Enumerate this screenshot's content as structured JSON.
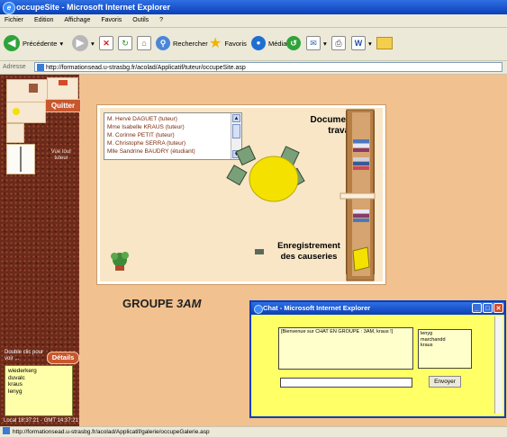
{
  "window": {
    "title": "occupeSite - Microsoft Internet Explorer"
  },
  "menu": [
    "Fichier",
    "Edition",
    "Affichage",
    "Favoris",
    "Outils",
    "?"
  ],
  "toolbar": {
    "back_label": "Précédente",
    "search_label": "Rechercher",
    "favorites_label": "Favoris",
    "media_label": "Média"
  },
  "address": {
    "label": "Adresse",
    "url": "http://formationsead.u-strasbg.fr/acolad/Applicatif/tuteur/occupeSite.asp"
  },
  "sidebar": {
    "quit_label": "Quitter",
    "tutor_move_label": "Vue tour tuteur",
    "dblclick_label": "Double clic pour voir ...",
    "details_label": "Détails",
    "users": [
      "wiederkerg",
      "duvalc",
      "kraus",
      "lenyg"
    ],
    "local_time": "Local 18:37:21 - GMT 14:37:21"
  },
  "room": {
    "tutors": [
      "M. Hervé DAGUET (tuteur)",
      "Mme Isabelle KRAUS (tuteur)",
      "M. Corinne PETIT (tuteur)",
      "M. Christophe SERRA (tuteur)",
      "Mlle Sandrine BAUDRY (étudiant)"
    ],
    "docs_label": "Documents de travail",
    "recordings_label": "Enregistrement des causeries"
  },
  "group": {
    "prefix": "GROUPE ",
    "name": "3AM"
  },
  "chat": {
    "title": "Chat - Microsoft Internet Explorer",
    "welcome": "[Bienvenue sur CHAT EN GROUPE : 3AM, kraus !]",
    "users": [
      "lenyg",
      "marchandd",
      "kraus"
    ],
    "send_label": "Envoyer"
  },
  "status": {
    "url": "http://formationsead.u-strasbg.fr/acolad/Applicatif/galerie/occupeGalerie.asp"
  },
  "colors": {
    "title_bar": "#0a3fb8",
    "content_bg": "#f1c18f",
    "left_panel": "#6b2a1a",
    "chat_bg": "#ffff66",
    "table_yellow": "#f5e100"
  }
}
